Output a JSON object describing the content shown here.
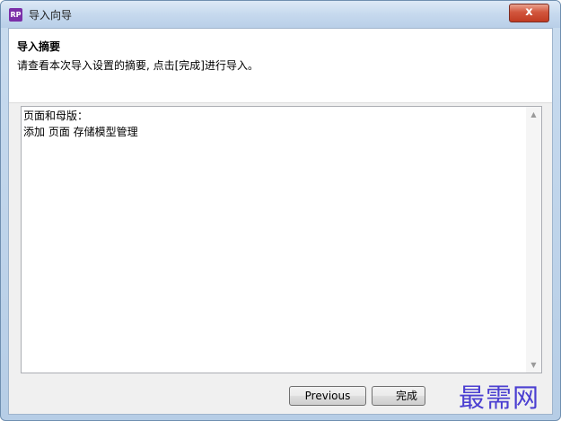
{
  "window": {
    "title": "导入向导",
    "app_icon_text": "RP",
    "close_glyph": "x"
  },
  "header": {
    "heading": "导入摘要",
    "description": "请查看本次导入设置的摘要, 点击[完成]进行导入。"
  },
  "summary": {
    "lines": [
      "页面和母版：",
      "添加 页面 存储模型管理"
    ]
  },
  "scrollbar": {
    "up_glyph": "▲",
    "down_glyph": "▼"
  },
  "buttons": {
    "previous_label": "Previous",
    "finish_label": "完成"
  },
  "watermark": {
    "text": "最需网"
  },
  "colors": {
    "app_icon": "#7b2fa8",
    "close_button": "#c13b22",
    "watermark": "#4b3fd1"
  }
}
